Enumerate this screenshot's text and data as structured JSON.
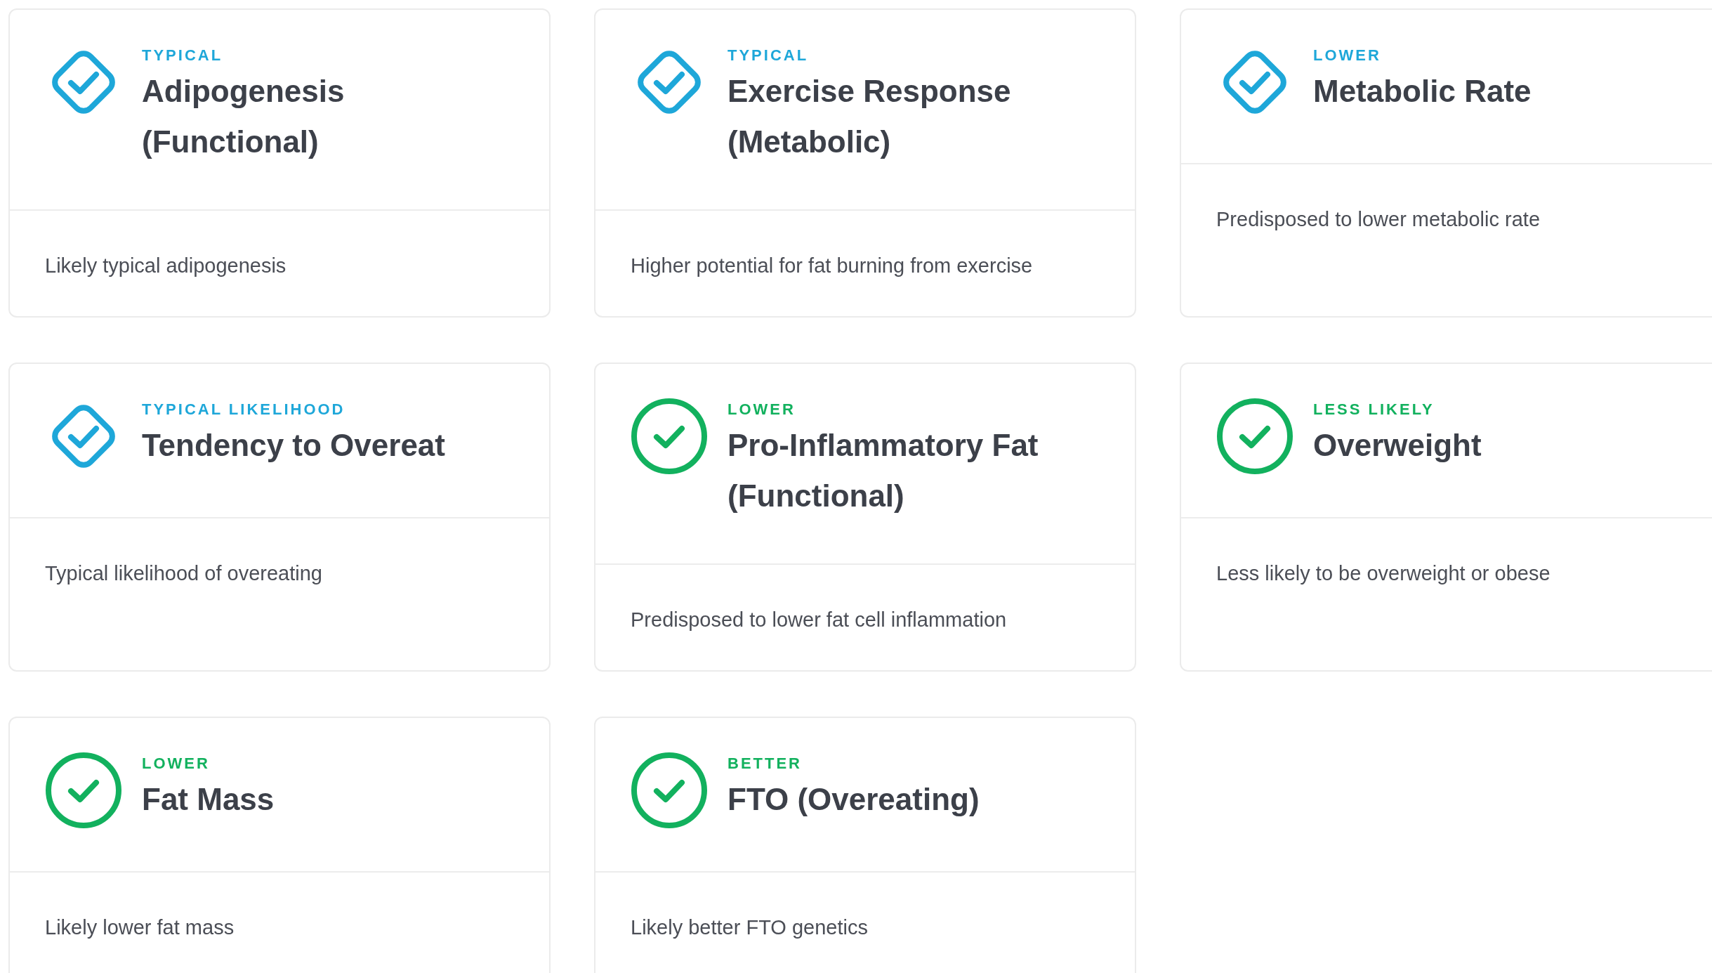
{
  "cards": [
    {
      "kind": "diamond",
      "color": "#1ea7d9",
      "category": "TYPICAL",
      "title": "Adipogenesis (Functional)",
      "description": "Likely typical adipogenesis"
    },
    {
      "kind": "diamond",
      "color": "#1ea7d9",
      "category": "TYPICAL",
      "title": "Exercise Response (Metabolic)",
      "description": "Higher potential for fat burning from exercise"
    },
    {
      "kind": "diamond",
      "color": "#1ea7d9",
      "category": "LOWER",
      "title": "Metabolic Rate",
      "description": "Predisposed to lower metabolic rate"
    },
    {
      "kind": "diamond",
      "color": "#1ea7d9",
      "category": "TYPICAL LIKELIHOOD",
      "title": "Tendency to Overeat",
      "description": "Typical likelihood of overeating"
    },
    {
      "kind": "circle",
      "color": "#12b15e",
      "category": "LOWER",
      "title": "Pro-Inflammatory Fat (Functional)",
      "description": "Predisposed to lower fat cell inflammation"
    },
    {
      "kind": "circle",
      "color": "#12b15e",
      "category": "LESS LIKELY",
      "title": "Overweight",
      "description": "Less likely to be overweight or obese"
    },
    {
      "kind": "circle",
      "color": "#12b15e",
      "category": "LOWER",
      "title": "Fat Mass",
      "description": "Likely lower fat mass"
    },
    {
      "kind": "circle",
      "color": "#12b15e",
      "category": "BETTER",
      "title": "FTO (Overeating)",
      "description": "Likely better FTO genetics"
    }
  ]
}
